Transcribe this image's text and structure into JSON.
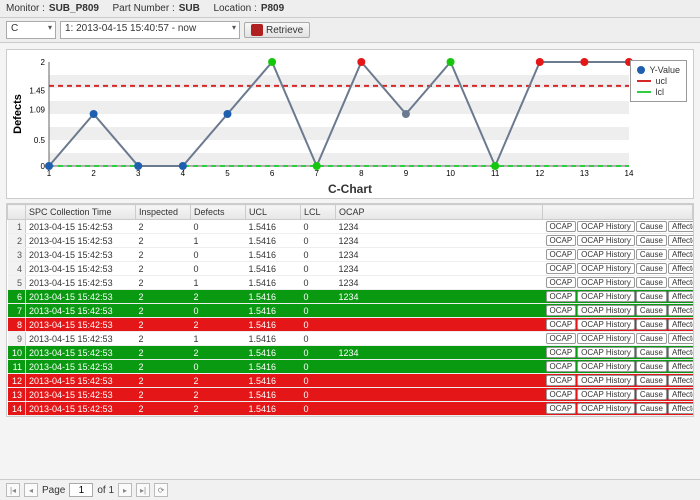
{
  "header": {
    "monitor_label": "Monitor :",
    "monitor_value": "SUB_P809",
    "part_label": "Part Number :",
    "part_value": "SUB",
    "location_label": "Location :",
    "location_value": "P809"
  },
  "toolbar": {
    "mode": "C",
    "range": "1: 2013-04-15 15:40:57 - now",
    "retrieve": "Retrieve"
  },
  "chart_data": {
    "type": "line",
    "title": "C-Chart",
    "ylabel": "Defects",
    "xlabel": "",
    "x": [
      1,
      2,
      3,
      4,
      5,
      6,
      7,
      8,
      9,
      10,
      11,
      12,
      13,
      14
    ],
    "ylim": [
      0,
      2
    ],
    "yticks": [
      0,
      0.5,
      1.09,
      1.45,
      2
    ],
    "ucl": 1.5416,
    "lcl": 0,
    "series": [
      {
        "name": "Y-Value",
        "values": [
          0,
          1,
          0,
          0,
          1,
          2,
          0,
          2,
          1,
          2,
          0,
          2,
          2,
          2
        ],
        "color_idx": [
          "b",
          "b",
          "b",
          "b",
          "b",
          "g",
          "g",
          "r",
          "n",
          "g",
          "g",
          "r",
          "r",
          "r"
        ]
      }
    ],
    "legend": [
      {
        "name": "Y-Value",
        "color": "#1f5fb0",
        "type": "dot"
      },
      {
        "name": "ucl",
        "color": "#d62728",
        "type": "line"
      },
      {
        "name": "lcl",
        "color": "#2ecc40",
        "type": "line"
      }
    ]
  },
  "table": {
    "columns": [
      "SPC Collection Time",
      "Inspected",
      "Defects",
      "UCL",
      "LCL",
      "OCAP"
    ],
    "action_labels": [
      "OCAP",
      "OCAP History",
      "Cause",
      "Affected S/Ns"
    ],
    "rows": [
      {
        "n": 1,
        "t": "2013-04-15 15:42:53",
        "insp": "2",
        "def": "0",
        "ucl": "1.5416",
        "lcl": "0",
        "ocap": "1234",
        "state": ""
      },
      {
        "n": 2,
        "t": "2013-04-15 15:42:53",
        "insp": "2",
        "def": "1",
        "ucl": "1.5416",
        "lcl": "0",
        "ocap": "1234",
        "state": ""
      },
      {
        "n": 3,
        "t": "2013-04-15 15:42:53",
        "insp": "2",
        "def": "0",
        "ucl": "1.5416",
        "lcl": "0",
        "ocap": "1234",
        "state": ""
      },
      {
        "n": 4,
        "t": "2013-04-15 15:42:53",
        "insp": "2",
        "def": "0",
        "ucl": "1.5416",
        "lcl": "0",
        "ocap": "1234",
        "state": ""
      },
      {
        "n": 5,
        "t": "2013-04-15 15:42:53",
        "insp": "2",
        "def": "1",
        "ucl": "1.5416",
        "lcl": "0",
        "ocap": "1234",
        "state": ""
      },
      {
        "n": 6,
        "t": "2013-04-15 15:42:53",
        "insp": "2",
        "def": "2",
        "ucl": "1.5416",
        "lcl": "0",
        "ocap": "1234",
        "state": "green"
      },
      {
        "n": 7,
        "t": "2013-04-15 15:42:53",
        "insp": "2",
        "def": "0",
        "ucl": "1.5416",
        "lcl": "0",
        "ocap": "",
        "state": "green"
      },
      {
        "n": 8,
        "t": "2013-04-15 15:42:53",
        "insp": "2",
        "def": "2",
        "ucl": "1.5416",
        "lcl": "0",
        "ocap": "",
        "state": "red"
      },
      {
        "n": 9,
        "t": "2013-04-15 15:42:53",
        "insp": "2",
        "def": "1",
        "ucl": "1.5416",
        "lcl": "0",
        "ocap": "",
        "state": ""
      },
      {
        "n": 10,
        "t": "2013-04-15 15:42:53",
        "insp": "2",
        "def": "2",
        "ucl": "1.5416",
        "lcl": "0",
        "ocap": "1234",
        "state": "green"
      },
      {
        "n": 11,
        "t": "2013-04-15 15:42:53",
        "insp": "2",
        "def": "0",
        "ucl": "1.5416",
        "lcl": "0",
        "ocap": "",
        "state": "green"
      },
      {
        "n": 12,
        "t": "2013-04-15 15:42:53",
        "insp": "2",
        "def": "2",
        "ucl": "1.5416",
        "lcl": "0",
        "ocap": "",
        "state": "red"
      },
      {
        "n": 13,
        "t": "2013-04-15 15:42:53",
        "insp": "2",
        "def": "2",
        "ucl": "1.5416",
        "lcl": "0",
        "ocap": "",
        "state": "red"
      },
      {
        "n": 14,
        "t": "2013-04-15 15:42:53",
        "insp": "2",
        "def": "2",
        "ucl": "1.5416",
        "lcl": "0",
        "ocap": "",
        "state": "red"
      }
    ]
  },
  "pager": {
    "page_label": "Page",
    "page": "1",
    "of_label": "of 1"
  }
}
